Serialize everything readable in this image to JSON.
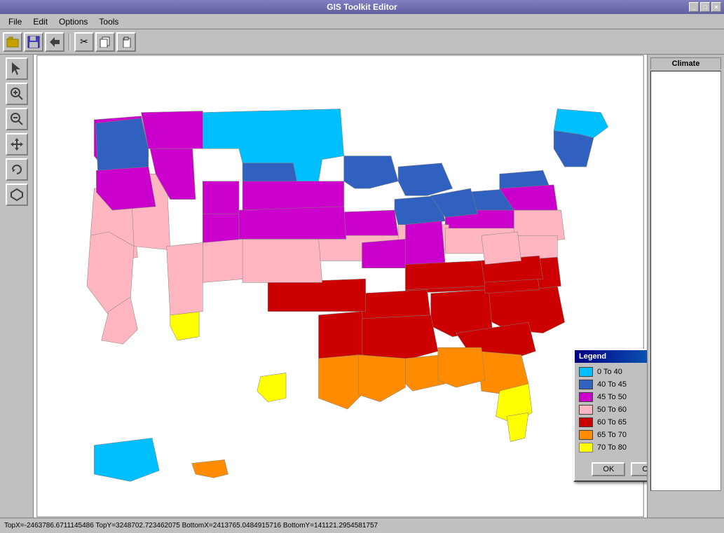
{
  "window": {
    "title": "GIS Toolkit Editor"
  },
  "menu": {
    "items": [
      "File",
      "Edit",
      "Options",
      "Tools"
    ]
  },
  "toolbar": {
    "buttons": [
      {
        "name": "open",
        "icon": "📂"
      },
      {
        "name": "save",
        "icon": "💾"
      },
      {
        "name": "back",
        "icon": "◀"
      },
      {
        "name": "cut",
        "icon": "✂"
      },
      {
        "name": "copy",
        "icon": "📋"
      },
      {
        "name": "paste",
        "icon": "📌"
      }
    ]
  },
  "left_tools": [
    {
      "name": "arrow",
      "icon": "↖"
    },
    {
      "name": "zoom-in",
      "icon": "🔍"
    },
    {
      "name": "zoom-out",
      "icon": "🔎"
    },
    {
      "name": "pan",
      "icon": "✛"
    },
    {
      "name": "rotate",
      "icon": "↻"
    },
    {
      "name": "polygon",
      "icon": "◇"
    }
  ],
  "right_panel": {
    "tab_label": "Climate"
  },
  "legend": {
    "title": "Legend",
    "items": [
      {
        "label": "0 To 40",
        "color": "#00BFFF"
      },
      {
        "label": "40 To 45",
        "color": "#3060C0"
      },
      {
        "label": "45 To 50",
        "color": "#CC00CC"
      },
      {
        "label": "50 To 60",
        "color": "#FFB6C1"
      },
      {
        "label": "60 To 65",
        "color": "#CC0000"
      },
      {
        "label": "65 To 70",
        "color": "#FF8C00"
      },
      {
        "label": "70 To 80",
        "color": "#FFFF00"
      }
    ],
    "ok_label": "OK",
    "cancel_label": "Cancel"
  },
  "status_bar": {
    "text": "TopX=-2463786.6711145486 TopY=3248702.723462075 BottomX=2413765.0484915716 BottomY=141121.2954581757"
  }
}
